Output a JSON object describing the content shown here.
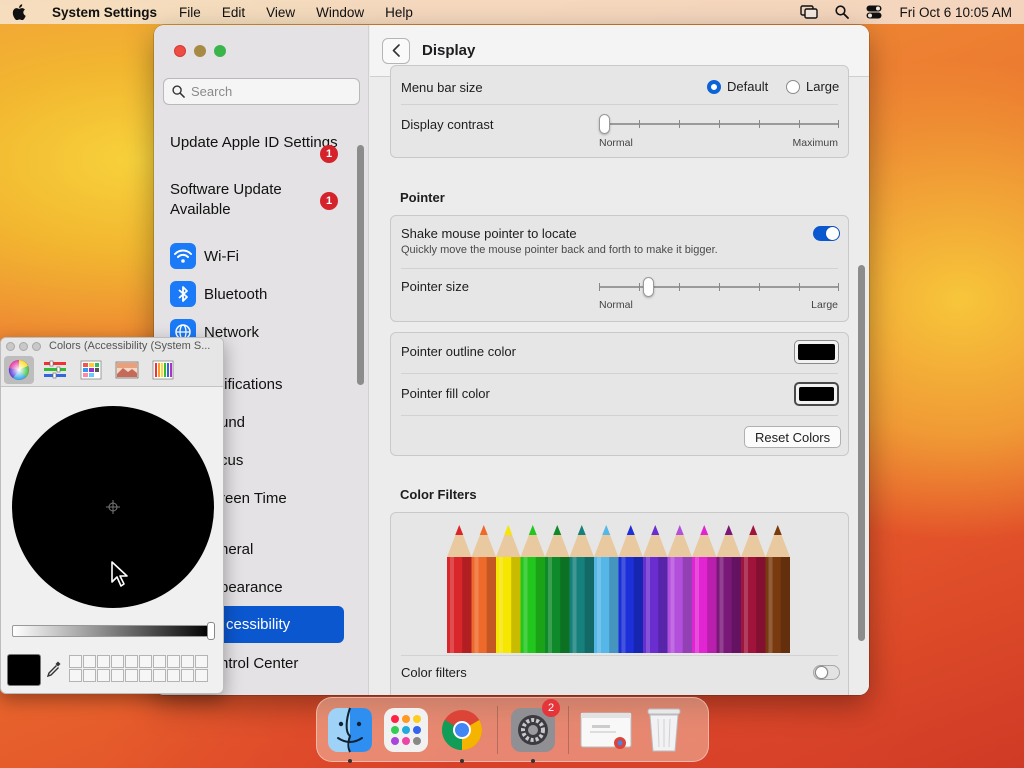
{
  "menubar": {
    "app_name": "System Settings",
    "menus": [
      "File",
      "Edit",
      "View",
      "Window",
      "Help"
    ],
    "clock": "Fri Oct 6  10:05 AM"
  },
  "sidebar": {
    "search_placeholder": "Search",
    "notices": [
      {
        "label": "Update Apple ID Settings",
        "badge": "1"
      },
      {
        "label": "Software Update Available",
        "badge": "1"
      }
    ],
    "items": [
      {
        "label": "Wi-Fi",
        "icon": "wifi-icon"
      },
      {
        "label": "Bluetooth",
        "icon": "bluetooth-icon"
      },
      {
        "label": "Network",
        "icon": "globe-icon"
      },
      {
        "label": "tifications"
      },
      {
        "label": "und"
      },
      {
        "label": "cus"
      },
      {
        "label": "reen Time"
      },
      {
        "label": "neral"
      },
      {
        "label": "pearance"
      },
      {
        "label": "cessibility",
        "selected": true
      },
      {
        "label": "ntrol Center"
      }
    ]
  },
  "content": {
    "title": "Display",
    "menu_bar_size": {
      "label": "Menu bar size",
      "options": [
        "Default",
        "Large"
      ],
      "selected": "Default"
    },
    "display_contrast": {
      "label": "Display contrast",
      "min_label": "Normal",
      "max_label": "Maximum",
      "level": 0.0
    },
    "pointer_section": "Pointer",
    "shake": {
      "label": "Shake mouse pointer to locate",
      "description": "Quickly move the mouse pointer back and forth to make it bigger.",
      "enabled": true
    },
    "pointer_size": {
      "label": "Pointer size",
      "min_label": "Normal",
      "max_label": "Large",
      "level": 0.19
    },
    "outline_color": {
      "label": "Pointer outline color",
      "value": "#000000"
    },
    "fill_color": {
      "label": "Pointer fill color",
      "value": "#000000"
    },
    "reset_label": "Reset Colors",
    "color_filters_section": "Color Filters",
    "color_filters": {
      "label": "Color filters",
      "enabled": false
    },
    "pencil_colors": [
      "#d8262b",
      "#ee6a2a",
      "#f6e600",
      "#22c71d",
      "#0f8a2a",
      "#16807c",
      "#55b6e8",
      "#1c2fd8",
      "#6a2ed0",
      "#b24fdc",
      "#e225d2",
      "#7a1878",
      "#a0143c",
      "#7a3a10"
    ]
  },
  "colors_panel": {
    "title": "Colors (Accessibility (System S...",
    "selected_color": "#000000",
    "brightness": 0.0
  },
  "dock": {
    "settings_badge": "2"
  }
}
